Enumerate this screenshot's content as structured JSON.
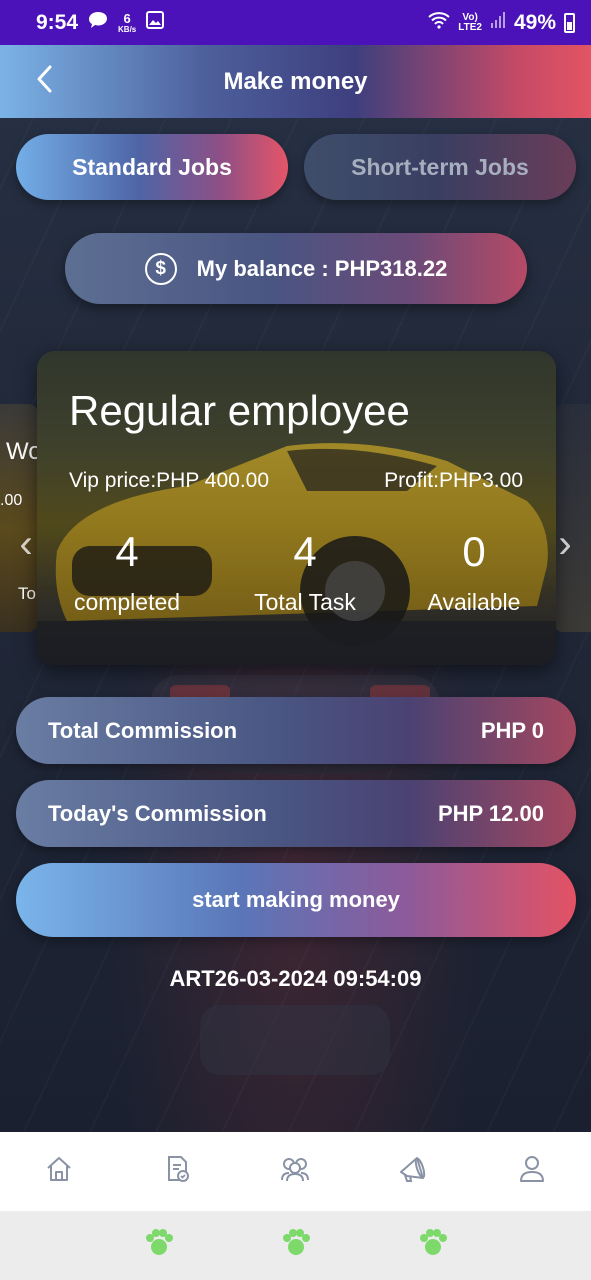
{
  "status_bar": {
    "time": "9:54",
    "speed_value": "6",
    "speed_unit": "KB/s",
    "network_top": "Vo)",
    "network_bottom": "LTE2",
    "battery": "49%"
  },
  "header": {
    "title": "Make money",
    "back_icon": "chevron-left-icon"
  },
  "tabs": [
    {
      "label": "Standard Jobs",
      "active": true
    },
    {
      "label": "Short-term Jobs",
      "active": false
    }
  ],
  "balance": {
    "icon": "dollar-coin-icon",
    "label": "My balance : PHP318.22"
  },
  "side_card_left": {
    "title": "Wo",
    "price": ".00",
    "label": "To"
  },
  "card": {
    "title": "Regular employee",
    "vip_price": "Vip price:PHP 400.00",
    "profit": "Profit:PHP3.00",
    "stats": [
      {
        "value": "4",
        "label": "completed"
      },
      {
        "value": "4",
        "label": "Total Task"
      },
      {
        "value": "0",
        "label": "Available"
      }
    ]
  },
  "commissions": {
    "total_label": "Total Commission",
    "total_value": "PHP 0",
    "today_label": "Today's Commission",
    "today_value": "PHP 12.00"
  },
  "start_button": "start making money",
  "timestamp": "ART26-03-2024 09:54:09",
  "bottom_nav": [
    "home-icon",
    "tasks-icon",
    "team-icon",
    "promote-icon",
    "profile-icon"
  ],
  "colors": {
    "status_bar": "#4a12b8",
    "accent_blue": "#7bb3e6",
    "accent_red": "#e35464",
    "nav_icon": "#8a93a6",
    "paw_green": "#7ed96b"
  }
}
